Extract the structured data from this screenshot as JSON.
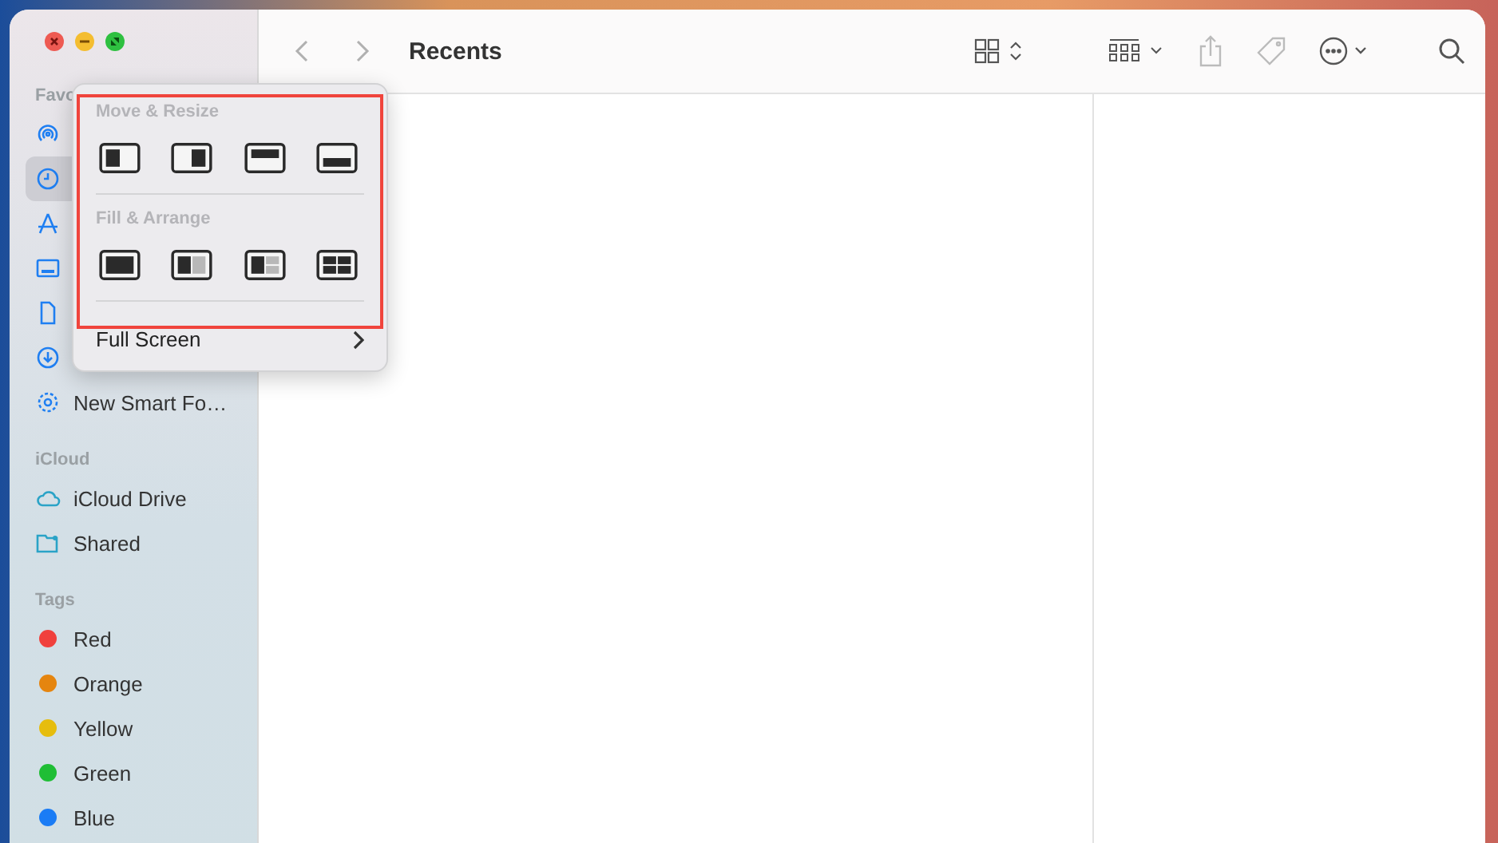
{
  "window": {
    "title": "Recents"
  },
  "sidebar": {
    "sections": [
      {
        "title": "Favo",
        "items": [
          {
            "kind": "airdrop",
            "selected": false
          },
          {
            "kind": "clock",
            "selected": true
          },
          {
            "kind": "apps",
            "selected": false
          },
          {
            "kind": "desktop",
            "selected": false
          },
          {
            "kind": "document",
            "selected": false
          },
          {
            "kind": "download",
            "selected": false
          },
          {
            "kind": "gear",
            "label": "New Smart Fo…",
            "selected": false
          }
        ]
      },
      {
        "title": "iCloud",
        "items": [
          {
            "kind": "cloud",
            "label": "iCloud Drive",
            "selected": false
          },
          {
            "kind": "shared",
            "label": "Shared",
            "selected": false
          }
        ]
      },
      {
        "title": "Tags",
        "items": [
          {
            "kind": "tag",
            "label": "Red",
            "color": "#f0403c",
            "selected": false
          },
          {
            "kind": "tag",
            "label": "Orange",
            "color": "#e5850f",
            "selected": false
          },
          {
            "kind": "tag",
            "label": "Yellow",
            "color": "#e6bd0d",
            "selected": false
          },
          {
            "kind": "tag",
            "label": "Green",
            "color": "#1fbe35",
            "selected": false
          },
          {
            "kind": "tag",
            "label": "Blue",
            "color": "#1a7cf5",
            "selected": false
          }
        ]
      }
    ]
  },
  "popup": {
    "sections": [
      {
        "title": "Move & Resize",
        "options": [
          {
            "kind": "left"
          },
          {
            "kind": "right"
          },
          {
            "kind": "top"
          },
          {
            "kind": "bottom"
          }
        ]
      },
      {
        "title": "Fill & Arrange",
        "options": [
          {
            "kind": "full"
          },
          {
            "kind": "halves"
          },
          {
            "kind": "thirds"
          },
          {
            "kind": "quarters"
          }
        ]
      }
    ],
    "full_screen": "Full Screen"
  }
}
